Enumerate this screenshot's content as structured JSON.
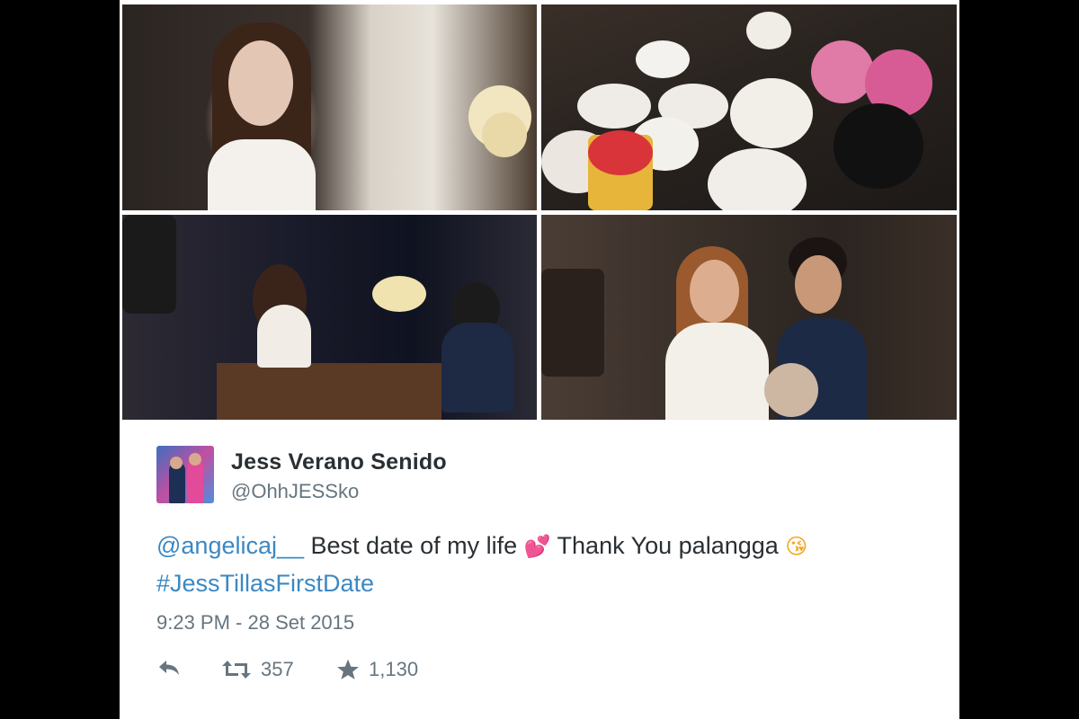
{
  "tweet": {
    "author_name": "Jess Verano Senido",
    "author_handle": "@OhhJESSko",
    "mention": "@angelicaj__",
    "text_part1": " Best date of my life ",
    "text_part2": " Thank You palangga ",
    "hashtag": "#JessTillasFirstDate",
    "emoji_1": "💕",
    "emoji_2": "😘",
    "timestamp": "9:23 PM - 28 Set 2015",
    "retweet_count": "357",
    "like_count": "1,130"
  },
  "icons": {
    "reply": "reply-icon",
    "retweet": "retweet-icon",
    "like": "star-icon"
  },
  "colors": {
    "link": "#3b88c3",
    "name": "#292f33",
    "meta": "#66757f"
  }
}
